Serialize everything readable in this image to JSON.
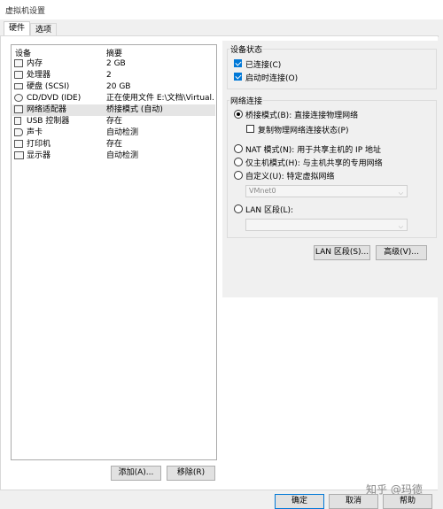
{
  "window": {
    "title": "虚拟机设置"
  },
  "tabs": [
    {
      "label": "硬件",
      "active": true
    },
    {
      "label": "选项",
      "active": false
    }
  ],
  "device_list": {
    "headers": {
      "device": "设备",
      "summary": "摘要"
    },
    "rows": [
      {
        "icon": "memory-icon",
        "device": "内存",
        "summary": "2 GB"
      },
      {
        "icon": "processor-icon",
        "device": "处理器",
        "summary": "2"
      },
      {
        "icon": "harddisk-icon",
        "device": "硬盘 (SCSI)",
        "summary": "20 GB"
      },
      {
        "icon": "cd-dvd-icon",
        "device": "CD/DVD (IDE)",
        "summary": "正在使用文件 E:\\文档\\Virtual..."
      },
      {
        "icon": "network-adapter-icon",
        "device": "网络适配器",
        "summary": "桥接模式 (自动)",
        "selected": true
      },
      {
        "icon": "usb-icon",
        "device": "USB 控制器",
        "summary": "存在"
      },
      {
        "icon": "sound-icon",
        "device": "声卡",
        "summary": "自动检测"
      },
      {
        "icon": "printer-icon",
        "device": "打印机",
        "summary": "存在"
      },
      {
        "icon": "display-icon",
        "device": "显示器",
        "summary": "自动检测"
      }
    ],
    "add_button": "添加(A)...",
    "remove_button": "移除(R)"
  },
  "device_status": {
    "title": "设备状态",
    "connected": {
      "label": "已连接(C)",
      "checked": true
    },
    "connect_at_power_on": {
      "label": "启动时连接(O)",
      "checked": true
    }
  },
  "network_connection": {
    "title": "网络连接",
    "bridged": {
      "label": "桥接模式(B): 直接连接物理网络",
      "selected": true
    },
    "replicate": {
      "label": "复制物理网络连接状态(P)",
      "checked": false
    },
    "nat": {
      "label": "NAT 模式(N): 用于共享主机的 IP 地址",
      "selected": false
    },
    "host_only": {
      "label": "仅主机模式(H): 与主机共享的专用网络",
      "selected": false
    },
    "custom": {
      "label": "自定义(U): 特定虚拟网络",
      "selected": false
    },
    "custom_select_value": "VMnet0",
    "lan_segment": {
      "label": "LAN 区段(L):",
      "selected": false
    },
    "lan_segment_select_value": ""
  },
  "buttons": {
    "lan_segments": "LAN 区段(S)...",
    "advanced": "高级(V)...",
    "ok": "确定",
    "cancel": "取消",
    "help": "帮助"
  },
  "watermark": "知乎 @玛德"
}
